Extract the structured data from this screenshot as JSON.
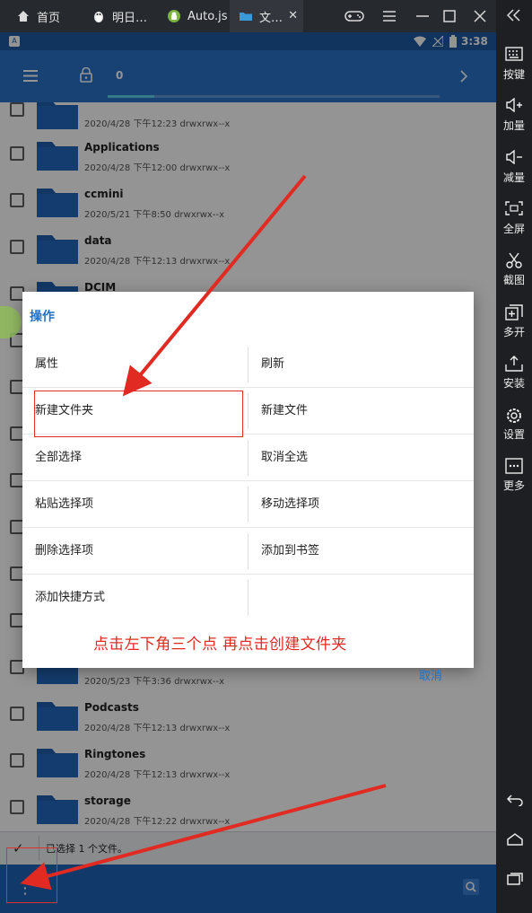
{
  "emulator": {
    "tabs": [
      {
        "label": "首页",
        "icon": "home-icon"
      },
      {
        "label": "明日…",
        "icon": "penguin-app-icon"
      },
      {
        "label": "Auto.js",
        "icon": "android-app-icon"
      },
      {
        "label": "文…",
        "icon": "folder-app-icon"
      }
    ],
    "active_tab": 3,
    "window_controls": [
      "gamepad-icon",
      "menu-icon",
      "minimize-icon",
      "maximize-icon",
      "close-icon"
    ]
  },
  "statusbar": {
    "time": "3:38",
    "left_icon": "A"
  },
  "appbar": {
    "path_count": "0",
    "icons": [
      "hamburger-menu-icon",
      "lock-icon",
      "chevron-right-icon"
    ]
  },
  "files": [
    {
      "name": "",
      "meta": "2020/4/28 下午12:23  drwxrwx--x"
    },
    {
      "name": "Applications",
      "meta": "2020/4/28 下午12:00  drwxrwx--x"
    },
    {
      "name": "ccmini",
      "meta": "2020/5/21 下午8:50  drwxrwx--x"
    },
    {
      "name": "data",
      "meta": "2020/4/28 下午12:13  drwxrwx--x"
    },
    {
      "name": "DCIM",
      "meta": ""
    },
    {
      "name": "",
      "meta": ""
    },
    {
      "name": "",
      "meta": ""
    },
    {
      "name": "",
      "meta": ""
    },
    {
      "name": "",
      "meta": ""
    },
    {
      "name": "",
      "meta": ""
    },
    {
      "name": "",
      "meta": ""
    },
    {
      "name": "",
      "meta": ""
    },
    {
      "name": "",
      "meta": "2020/5/23 下午3:36  drwxrwx--x"
    },
    {
      "name": "Podcasts",
      "meta": "2020/4/28 下午12:13  drwxrwx--x"
    },
    {
      "name": "Ringtones",
      "meta": "2020/4/28 下午12:13  drwxrwx--x"
    },
    {
      "name": "storage",
      "meta": "2020/4/28 下午12:22  drwxrwx--x"
    }
  ],
  "selection_bar": {
    "text": "已选择 1 个文件。"
  },
  "dialog": {
    "title": "操作",
    "options": [
      [
        "属性",
        "刷新"
      ],
      [
        "新建文件夹",
        "新建文件"
      ],
      [
        "全部选择",
        "取消全选"
      ],
      [
        "粘贴选择项",
        "移动选择项"
      ],
      [
        "删除选择项",
        "添加到书签"
      ],
      [
        "添加快捷方式",
        ""
      ]
    ],
    "cancel": "取消"
  },
  "annotation": {
    "hint": "点击左下角三个点  再点击创建文件夹"
  },
  "sidebar": {
    "items": [
      {
        "label": "按键",
        "icon": "keyboard-icon"
      },
      {
        "label": "加量",
        "icon": "volume-up-icon"
      },
      {
        "label": "减量",
        "icon": "volume-down-icon"
      },
      {
        "label": "全屏",
        "icon": "fullscreen-icon"
      },
      {
        "label": "截图",
        "icon": "scissors-icon"
      },
      {
        "label": "多开",
        "icon": "multi-instance-icon"
      },
      {
        "label": "安装",
        "icon": "install-icon"
      },
      {
        "label": "设置",
        "icon": "gear-icon"
      },
      {
        "label": "更多",
        "icon": "more-icon"
      }
    ],
    "nav": [
      "back-icon",
      "home-icon",
      "recents-icon"
    ],
    "collapse_icon": "double-chevron-left-icon"
  },
  "colors": {
    "primary": "#2a73c9",
    "accent_red": "#e02a22",
    "dialog_accent": "#2172c7"
  }
}
